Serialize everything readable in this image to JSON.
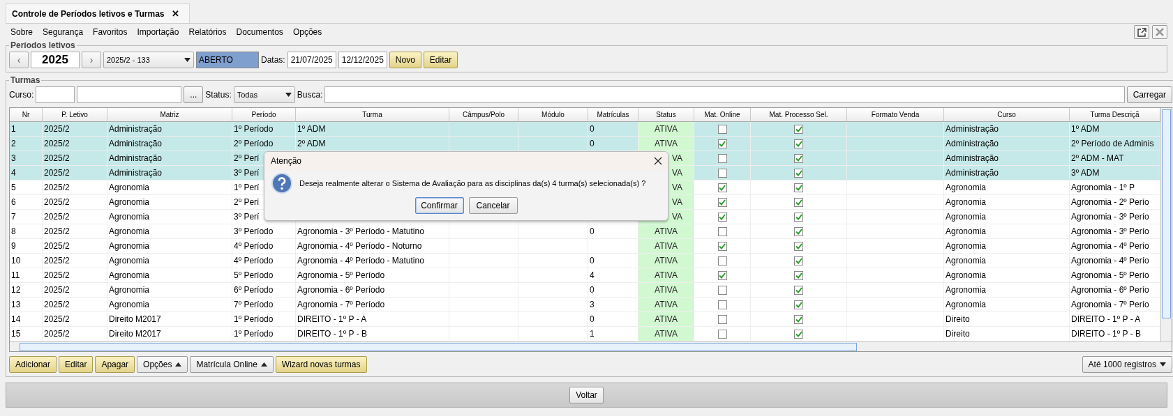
{
  "tab": {
    "title": "Controle de Períodos letivos e Turmas",
    "close": "✕"
  },
  "menu": [
    "Sobre",
    "Segurança",
    "Favoritos",
    "Importação",
    "Relatórios",
    "Documentos",
    "Opções"
  ],
  "periodos": {
    "legend": "Períodos letivos",
    "prev": "‹",
    "year": "2025",
    "next": "›",
    "periodo": "2025/2 - 133",
    "situacao": "ABERTO",
    "datas_label": "Datas:",
    "inicio": "21/07/2025",
    "fim": "12/12/2025",
    "buttons": [
      {
        "label": "Novo",
        "kind": "primary"
      },
      {
        "label": "Editar",
        "kind": "primary"
      }
    ]
  },
  "turmas": {
    "legend": "Turmas",
    "curso_label": "Curso:",
    "browse": "...",
    "status_label": "Status:",
    "status": "Todas",
    "busca_label": "Busca:",
    "carregar": "Carregar",
    "columns": [
      "Nr",
      "P. Letivo",
      "Matriz",
      "Período",
      "Turma",
      "Câmpus/Polo",
      "Módulo",
      "Matrículas",
      "Status",
      "Mat. Online",
      "Mat. Processo Sel.",
      "Formato Venda",
      "Curso",
      "Turma Descriçã"
    ],
    "rows": [
      {
        "nr": "1",
        "letivo": "2025/2",
        "matriz": "Administração",
        "periodo": "1º Período",
        "turma": "1º ADM",
        "matriculas": "0",
        "status": "ATIVA",
        "online": false,
        "processo": true,
        "curso": "Administração",
        "descricao": "1º ADM",
        "selected": true
      },
      {
        "nr": "2",
        "letivo": "2025/2",
        "matriz": "Administração",
        "periodo": "2º Período",
        "turma": "2º ADM",
        "matriculas": "0",
        "status": "ATIVA",
        "online": true,
        "processo": true,
        "curso": "Administração",
        "descricao": "2º Período de Adminis",
        "selected": true
      },
      {
        "nr": "3",
        "letivo": "2025/2",
        "matriz": "Administração",
        "periodo": "2º Perí",
        "status": "VA",
        "online": false,
        "processo": true,
        "curso": "Administração",
        "descricao": "2º ADM - MAT",
        "selected": true
      },
      {
        "nr": "4",
        "letivo": "2025/2",
        "matriz": "Administração",
        "periodo": "3º Perí",
        "status": "VA",
        "online": false,
        "processo": true,
        "curso": "Administração",
        "descricao": "3º ADM",
        "selected": true
      },
      {
        "nr": "5",
        "letivo": "2025/2",
        "matriz": "Agronomia",
        "periodo": "1º Perí",
        "status": "VA",
        "online": true,
        "processo": true,
        "curso": "Agronomia",
        "descricao": "Agronomia - 1º P",
        "selected": false
      },
      {
        "nr": "6",
        "letivo": "2025/2",
        "matriz": "Agronomia",
        "periodo": "2º Perí",
        "status": "VA",
        "online": true,
        "processo": true,
        "curso": "Agronomia",
        "descricao": "Agronomia - 2º Perío",
        "selected": false
      },
      {
        "nr": "7",
        "letivo": "2025/2",
        "matriz": "Agronomia",
        "periodo": "3º Perí",
        "status": "VA",
        "online": true,
        "processo": true,
        "curso": "Agronomia",
        "descricao": "Agronomia - 3º Perío",
        "selected": false
      },
      {
        "nr": "8",
        "letivo": "2025/2",
        "matriz": "Agronomia",
        "periodo": "3º Período",
        "turma": "Agronomia - 3º Período - Matutino",
        "matriculas": "0",
        "status": "ATIVA",
        "online": false,
        "processo": true,
        "curso": "Agronomia",
        "descricao": "Agronomia - 3º Perío",
        "selected": false
      },
      {
        "nr": "9",
        "letivo": "2025/2",
        "matriz": "Agronomia",
        "periodo": "4º Período",
        "turma": "Agronomia - 4º Período - Noturno",
        "status": "ATIVA",
        "online": true,
        "processo": true,
        "curso": "Agronomia",
        "descricao": "Agronomia - 4º Perío",
        "selected": false
      },
      {
        "nr": "10",
        "letivo": "2025/2",
        "matriz": "Agronomia",
        "periodo": "4º Período",
        "turma": "Agronomia - 4º Período - Matutino",
        "matriculas": "0",
        "status": "ATIVA",
        "online": false,
        "processo": true,
        "curso": "Agronomia",
        "descricao": "Agronomia - 4º Perío",
        "selected": false
      },
      {
        "nr": "11",
        "letivo": "2025/2",
        "matriz": "Agronomia",
        "periodo": "5º Período",
        "turma": "Agronomia - 5º Período",
        "matriculas": "4",
        "status": "ATIVA",
        "online": true,
        "processo": true,
        "curso": "Agronomia",
        "descricao": "Agronomia - 5º Perío",
        "selected": false
      },
      {
        "nr": "12",
        "letivo": "2025/2",
        "matriz": "Agronomia",
        "periodo": "6º Período",
        "turma": "Agronomia - 6º Período",
        "matriculas": "0",
        "status": "ATIVA",
        "online": false,
        "processo": true,
        "curso": "Agronomia",
        "descricao": "Agronomia - 6º Perío",
        "selected": false
      },
      {
        "nr": "13",
        "letivo": "2025/2",
        "matriz": "Agronomia",
        "periodo": "7º Período",
        "turma": "Agronomia - 7º Período",
        "matriculas": "3",
        "status": "ATIVA",
        "online": false,
        "processo": true,
        "curso": "Agronomia",
        "descricao": "Agronomia - 7º Perío",
        "selected": false
      },
      {
        "nr": "14",
        "letivo": "2025/2",
        "matriz": "Direito M2017",
        "periodo": "1º Período",
        "turma": "DIREITO - 1º P - A",
        "matriculas": "0",
        "status": "ATIVA",
        "online": false,
        "processo": true,
        "curso": "Direito",
        "descricao": "DIREITO - 1º P - A",
        "selected": false
      },
      {
        "nr": "15",
        "letivo": "2025/2",
        "matriz": "Direito M2017",
        "periodo": "1º Período",
        "turma": "DIREITO - 1º P - B",
        "matriculas": "1",
        "status": "ATIVA",
        "online": false,
        "processo": true,
        "curso": "Direito",
        "descricao": "DIREITO - 1º P - B",
        "selected": false
      }
    ],
    "buttons": [
      {
        "label": "Adicionar",
        "kind": "primary"
      },
      {
        "label": "Editar",
        "kind": "primary"
      },
      {
        "label": "Apagar",
        "kind": "primary"
      },
      {
        "label": "Opções",
        "kind": "menu"
      },
      {
        "label": "Matrícula Online",
        "kind": "menu"
      },
      {
        "label": "Wizard novas turmas",
        "kind": "primary"
      }
    ],
    "limit": "Até 1000 registros"
  },
  "voltar": "Voltar",
  "dialog": {
    "title": "Atenção",
    "message": "Deseja realmente alterar o Sistema de Avaliação para as disciplinas da(s) 4 turma(s) selecionada(s) ?",
    "buttons": [
      {
        "label": "Confirmar",
        "kind": "default"
      },
      {
        "label": "Cancelar",
        "kind": "normal"
      }
    ]
  }
}
